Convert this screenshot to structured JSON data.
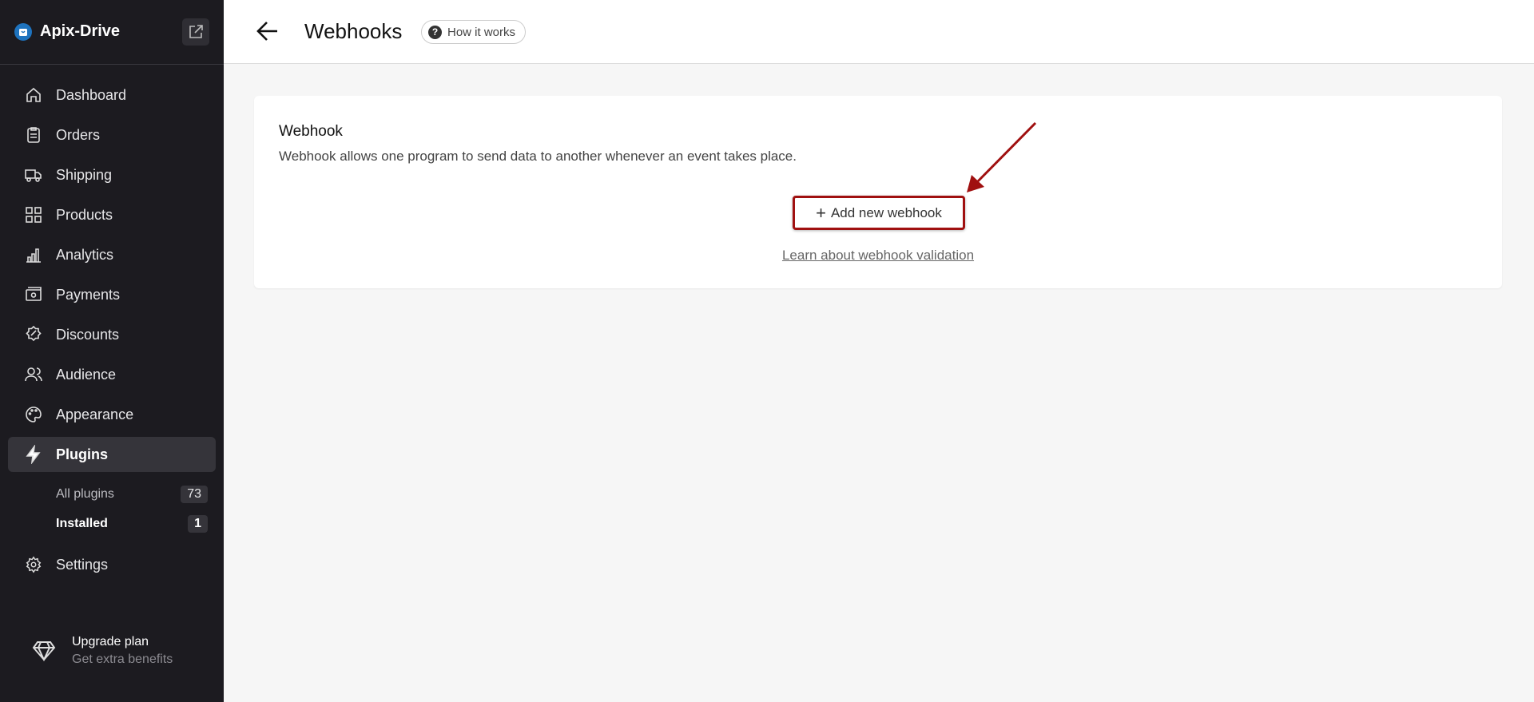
{
  "sidebar": {
    "brand": "Apix-Drive",
    "items": [
      {
        "label": "Dashboard",
        "icon": "home-icon"
      },
      {
        "label": "Orders",
        "icon": "clipboard-icon"
      },
      {
        "label": "Shipping",
        "icon": "truck-icon"
      },
      {
        "label": "Products",
        "icon": "grid-icon"
      },
      {
        "label": "Analytics",
        "icon": "bar-chart-icon"
      },
      {
        "label": "Payments",
        "icon": "cash-icon"
      },
      {
        "label": "Discounts",
        "icon": "discount-icon"
      },
      {
        "label": "Audience",
        "icon": "users-icon"
      },
      {
        "label": "Appearance",
        "icon": "palette-icon"
      },
      {
        "label": "Plugins",
        "icon": "bolt-icon"
      }
    ],
    "subitems": [
      {
        "label": "All plugins",
        "count": "73"
      },
      {
        "label": "Installed",
        "count": "1"
      }
    ],
    "settings": "Settings",
    "upgrade": {
      "title": "Upgrade plan",
      "subtitle": "Get extra benefits"
    }
  },
  "header": {
    "title": "Webhooks",
    "how": "How it works"
  },
  "card": {
    "title": "Webhook",
    "description": "Webhook allows one program to send data to another whenever an event takes place.",
    "add_button": "Add new webhook",
    "link": "Learn about webhook validation"
  },
  "colors": {
    "sidebar": "#1c1b20",
    "annotation": "#a01010",
    "brand": "#1e73be"
  }
}
